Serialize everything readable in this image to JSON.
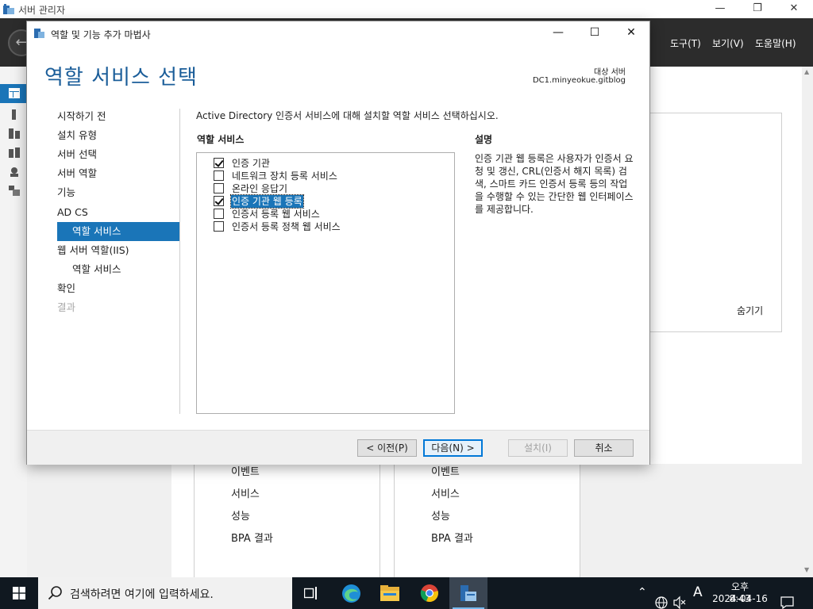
{
  "server_manager": {
    "title": "서버 관리자",
    "menu": [
      "도구(T)",
      "보기(V)",
      "도움말(H)"
    ],
    "menu_partial": ")",
    "hide_label": "숨기기",
    "tile1_links": [
      "이벤트",
      "서비스",
      "성능",
      "BPA 결과"
    ],
    "tile2_links": [
      "이벤트",
      "서비스",
      "성능",
      "BPA 결과"
    ],
    "accent_color": "#1a75b8"
  },
  "wizard": {
    "title": "역할 및 기능 추가 마법사",
    "heading": "역할 서비스 선택",
    "target_label": "대상 서버",
    "target_value": "DC1.minyeokue.gitblog",
    "intro": "Active Directory 인증서 서비스에 대해 설치할 역할 서비스 선택하십시오.",
    "nav": [
      {
        "label": "시작하기 전",
        "state": "normal"
      },
      {
        "label": "설치 유형",
        "state": "normal"
      },
      {
        "label": "서버 선택",
        "state": "normal"
      },
      {
        "label": "서버 역할",
        "state": "normal"
      },
      {
        "label": "기능",
        "state": "normal"
      },
      {
        "label": "AD CS",
        "state": "normal"
      },
      {
        "label": "역할 서비스",
        "state": "active"
      },
      {
        "label": "웹 서버 역할(IIS)",
        "state": "normal"
      },
      {
        "label": "역할 서비스",
        "state": "sub"
      },
      {
        "label": "확인",
        "state": "normal"
      },
      {
        "label": "결과",
        "state": "disabled"
      }
    ],
    "services_header": "역할 서비스",
    "services": [
      {
        "label": "인증 기관",
        "checked": true,
        "selected": false
      },
      {
        "label": "네트워크 장치 등록 서비스",
        "checked": false,
        "selected": false
      },
      {
        "label": "온라인 응답기",
        "checked": false,
        "selected": false
      },
      {
        "label": "인증 기관 웹 등록",
        "checked": true,
        "selected": true
      },
      {
        "label": "인증서 등록 웹 서비스",
        "checked": false,
        "selected": false
      },
      {
        "label": "인증서 등록 정책 웹 서비스",
        "checked": false,
        "selected": false
      }
    ],
    "description_header": "설명",
    "description": "인증 기관 웹 등록은 사용자가 인증서 요청 및 갱신, CRL(인증서 해지 목록) 검색, 스마트 카드 인증서 등록 등의 작업을 수행할 수 있는 간단한 웹 인터페이스를 제공합니다.",
    "buttons": {
      "prev": "< 이전(P)",
      "next": "다음(N) >",
      "install": "설치(I)",
      "cancel": "취소"
    }
  },
  "taskbar": {
    "search_placeholder": "검색하려면 여기에 입력하세요.",
    "ime": "A",
    "time": "오후 8:43",
    "date": "2024-04-16"
  }
}
